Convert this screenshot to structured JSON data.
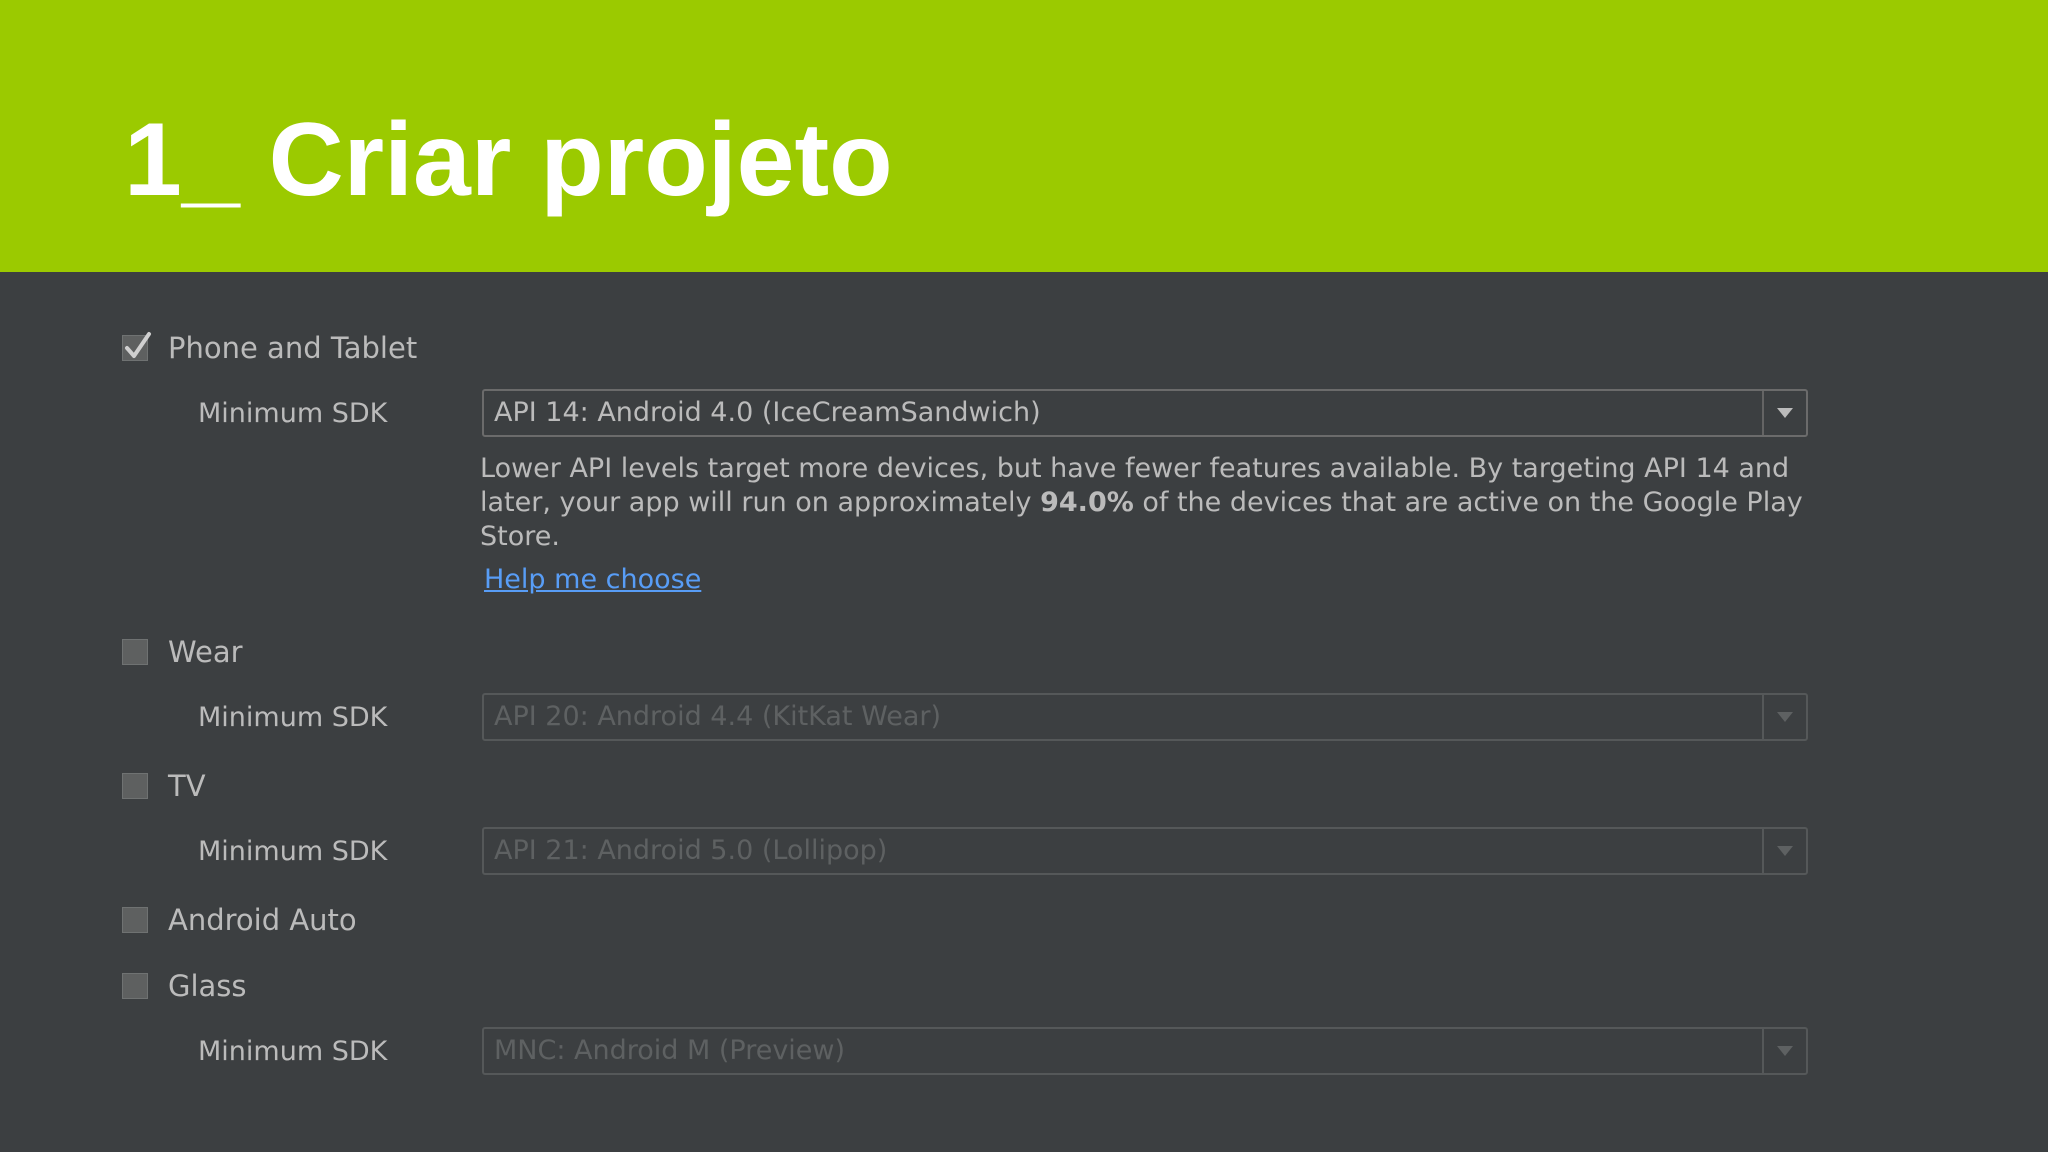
{
  "slide": {
    "title": "1_ Criar projeto"
  },
  "colors": {
    "header_green": "#9bca00",
    "panel_dark": "#3c3f41",
    "label_text": "#bbbbbb",
    "disabled_text": "#5e6162",
    "link_blue": "#589df6"
  },
  "form_factors": {
    "phone_tablet": {
      "label": "Phone and Tablet",
      "checked": true,
      "sdk_label": "Minimum SDK",
      "sdk_value": "API 14: Android 4.0 (IceCreamSandwich)",
      "description_part1": "Lower API levels target more devices, but have fewer features available. By targeting API 14 and later, your app will run on approximately ",
      "description_bold": "94.0%",
      "description_part2": " of the devices that are active on the Google Play Store.",
      "help_link": "Help me choose"
    },
    "wear": {
      "label": "Wear",
      "checked": false,
      "sdk_label": "Minimum SDK",
      "sdk_value": "API 20: Android 4.4 (KitKat Wear)"
    },
    "tv": {
      "label": "TV",
      "checked": false,
      "sdk_label": "Minimum SDK",
      "sdk_value": "API 21: Android 5.0 (Lollipop)"
    },
    "android_auto": {
      "label": "Android Auto",
      "checked": false
    },
    "glass": {
      "label": "Glass",
      "checked": false,
      "sdk_label": "Minimum SDK",
      "sdk_value": "MNC: Android M (Preview)"
    }
  }
}
